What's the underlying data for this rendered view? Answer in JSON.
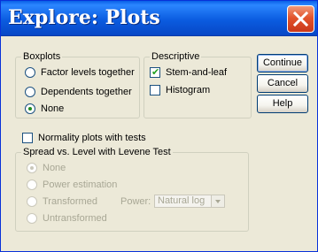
{
  "window": {
    "title": "Explore: Plots"
  },
  "boxplots": {
    "title": "Boxplots",
    "options": [
      {
        "label": "Factor levels together",
        "selected": false
      },
      {
        "label": "Dependents together",
        "selected": false
      },
      {
        "label": "None",
        "selected": true
      }
    ]
  },
  "descriptive": {
    "title": "Descriptive",
    "stem_leaf": {
      "label": "Stem-and-leaf",
      "checked": true
    },
    "histogram": {
      "label": "Histogram",
      "checked": false
    }
  },
  "buttons": {
    "continue": "Continue",
    "cancel": "Cancel",
    "help": "Help"
  },
  "normality": {
    "label": "Normality plots with tests",
    "checked": false
  },
  "spread": {
    "title": "Spread vs. Level with Levene Test",
    "options": [
      {
        "label": "None",
        "selected": true,
        "enabled": false
      },
      {
        "label": "Power estimation",
        "selected": false,
        "enabled": false
      },
      {
        "label": "Transformed",
        "selected": false,
        "enabled": false
      },
      {
        "label": "Untransformed",
        "selected": false,
        "enabled": false
      }
    ],
    "power_label": "Power:",
    "power_value": "Natural log"
  }
}
